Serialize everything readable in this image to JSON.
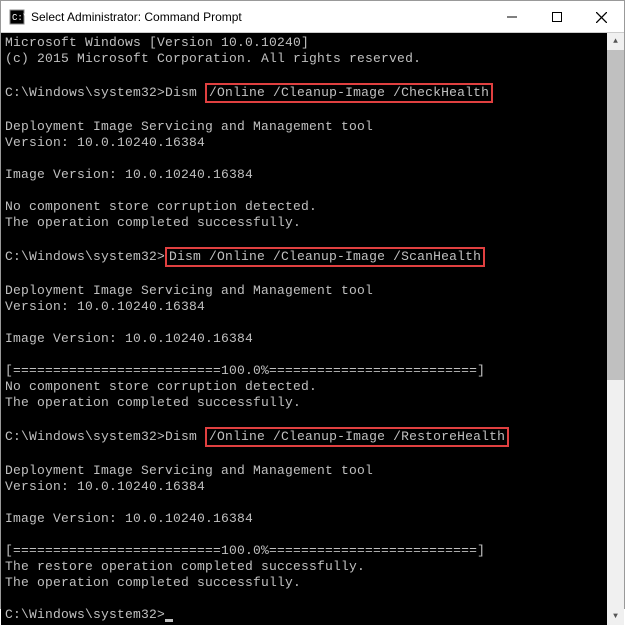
{
  "window": {
    "title": "Select Administrator: Command Prompt"
  },
  "output": {
    "os_line": "Microsoft Windows [Version 10.0.10240]",
    "copyright_line": "(c) 2015 Microsoft Corporation. All rights reserved.",
    "prompt1_prefix": "C:\\Windows\\system32>Dism ",
    "cmd1_highlighted": "/Online /Cleanup-Image /CheckHealth",
    "tool_line1": "Deployment Image Servicing and Management tool",
    "tool_line2": "Version: 10.0.10240.16384",
    "image_ver_line": "Image Version: 10.0.10240.16384",
    "no_corrupt_line": "No component store corruption detected.",
    "op_done_line": "The operation completed successfully.",
    "prompt2_prefix": "C:\\Windows\\system32>",
    "cmd2_highlighted": "Dism /Online /Cleanup-Image /ScanHealth",
    "progress_line": "[==========================100.0%==========================]",
    "prompt3_prefix": "C:\\Windows\\system32>Dism ",
    "cmd3_highlighted": "/Online /Cleanup-Image /RestoreHealth",
    "restore_done_line": "The restore operation completed successfully.",
    "final_prompt": "C:\\Windows\\system32>"
  }
}
